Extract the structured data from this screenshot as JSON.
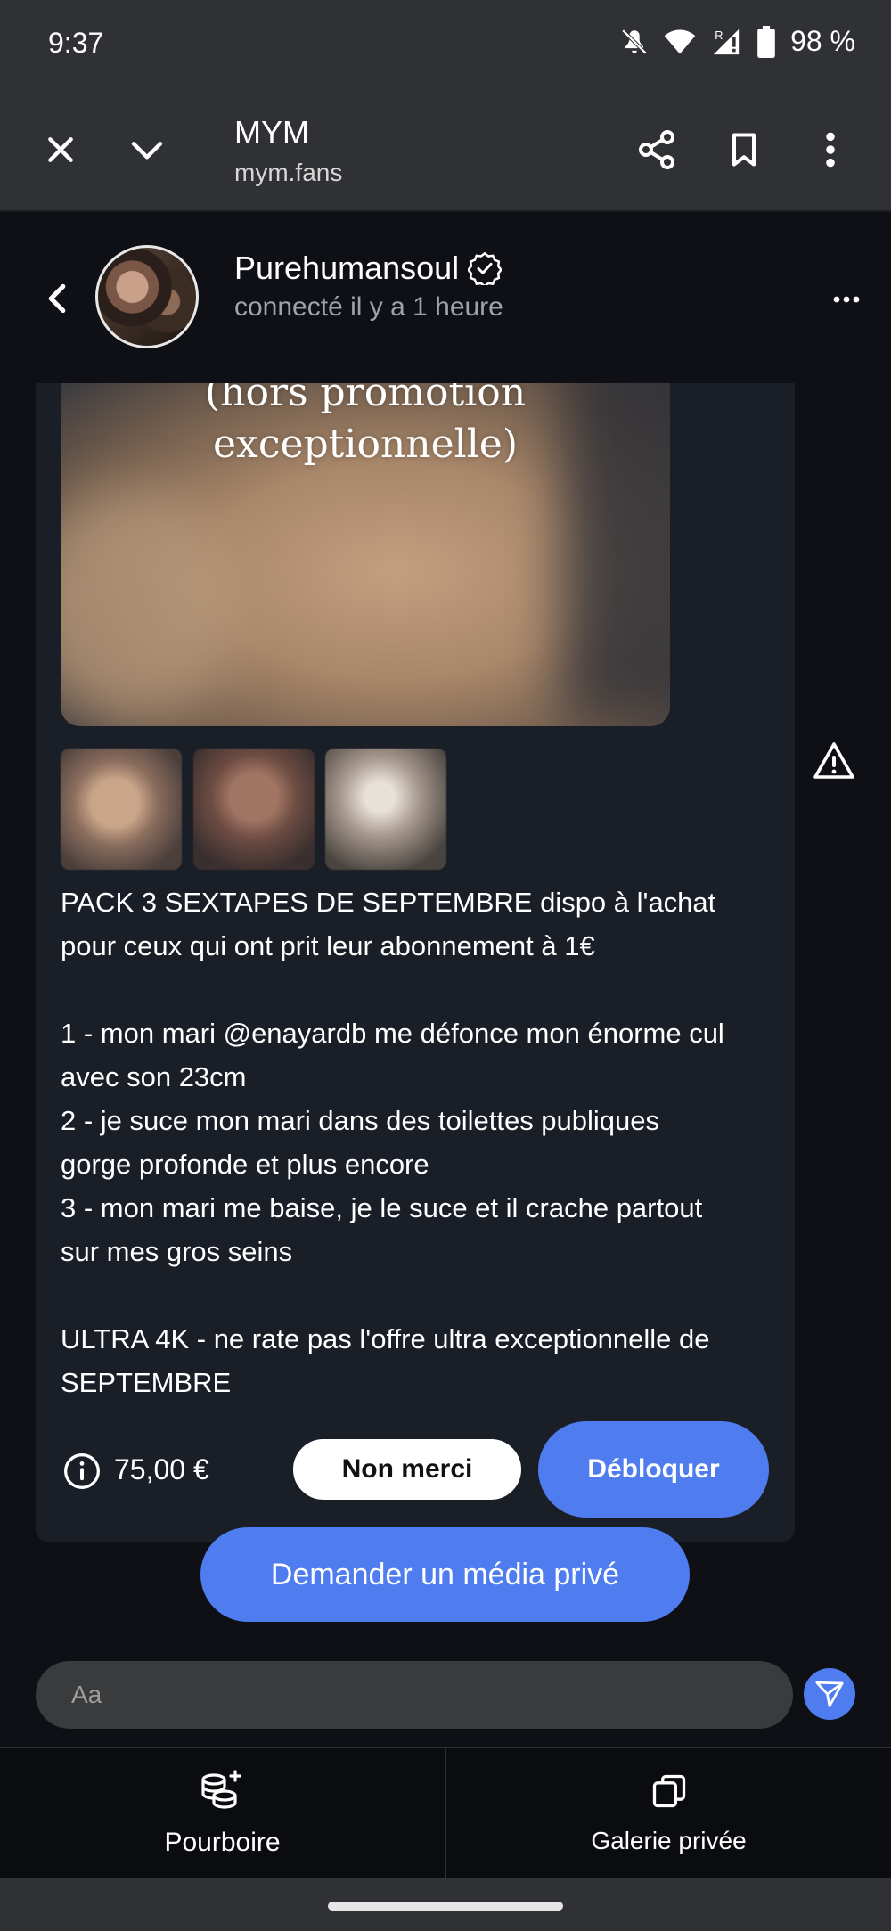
{
  "status_bar": {
    "time": "9:37",
    "battery": "98 %",
    "icons": [
      "mute-icon",
      "wifi-icon",
      "signal-icon",
      "battery-icon"
    ]
  },
  "browser": {
    "title": "MYM",
    "url": "mym.fans",
    "icons": [
      "close-icon",
      "chevron-down-icon",
      "share-icon",
      "bookmark-icon",
      "more-vertical-icon"
    ]
  },
  "chat": {
    "profile_name": "Purehumansoul",
    "profile_status": "connecté il y a 1 heure",
    "verified": true
  },
  "message": {
    "image_caption_line1": "(hors promotion",
    "image_caption_line2": "exceptionnelle)",
    "thumbnail_count": 3,
    "text": "PACK 3 SEXTAPES DE SEPTEMBRE dispo à l'achat\npour ceux qui ont prit leur abonnement à 1€\n\n1 - mon mari @enayardb me défonce mon énorme cul\navec son 23cm\n2 - je suce mon mari dans des toilettes publiques\ngorge profonde et plus encore\n3 - mon mari me baise, je le suce et il crache partout\nsur mes gros seins\n\nULTRA 4K - ne rate pas l'offre ultra exceptionnelle de\nSEPTEMBRE",
    "price": "75,00 €",
    "decline_label": "Non merci",
    "unlock_label": "Débloquer"
  },
  "actions": {
    "request_media_label": "Demander un média privé"
  },
  "composer": {
    "placeholder": "Aa"
  },
  "bottom_nav": {
    "tip_label": "Pourboire",
    "gallery_label": "Galerie privée"
  },
  "colors": {
    "accent": "#4f7df0",
    "background": "#0e1015",
    "card": "#1a1e27",
    "chrome": "#303134"
  }
}
